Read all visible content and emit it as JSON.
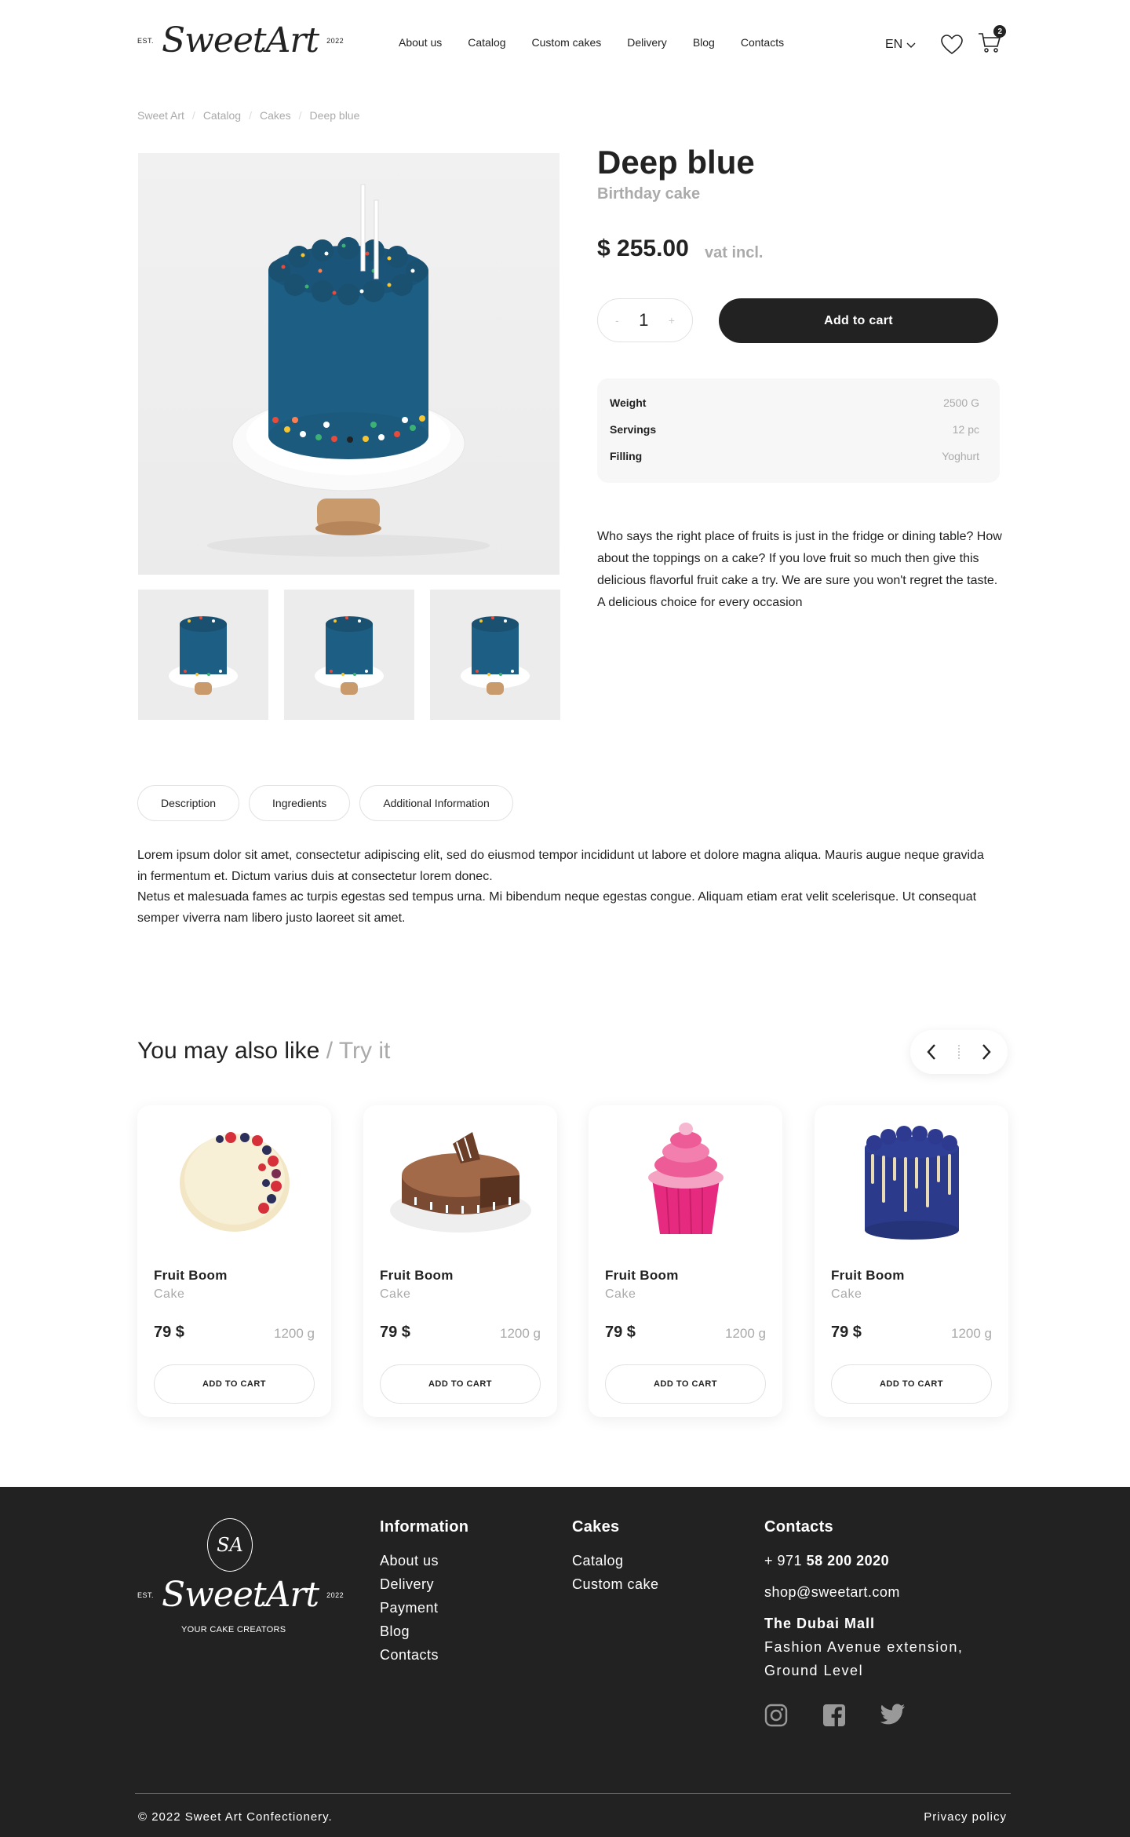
{
  "header": {
    "logo_est": "EST.",
    "logo_name": "SweetArt",
    "logo_year": "2022",
    "nav": [
      "About us",
      "Catalog",
      "Custom cakes",
      "Delivery",
      "Blog",
      "Contacts"
    ],
    "language": "EN",
    "cart_count": "2"
  },
  "breadcrumb": [
    "Sweet Art",
    "Catalog",
    "Cakes",
    "Deep blue"
  ],
  "product": {
    "title": "Deep blue",
    "subtitle": "Birthday cake",
    "price": "$ 255.00",
    "vat": "vat incl.",
    "qty_minus": "-",
    "quantity": "1",
    "qty_plus": "+",
    "add_to_cart": "Add to cart",
    "specs": [
      {
        "label": "Weight",
        "value": "2500 G"
      },
      {
        "label": "Servings",
        "value": "12 pc"
      },
      {
        "label": "Filling",
        "value": "Yoghurt"
      }
    ],
    "description": "Who says the right place of fruits is just in the fridge or dining table? How about the toppings on a cake? If you love fruit so much then give this delicious flavorful fruit cake a try. We are sure you won't regret the taste. A delicious choice for every occasion",
    "image_color": "#1d5f84"
  },
  "tabs": [
    "Description",
    "Ingredients",
    "Additional Information"
  ],
  "tab_content": [
    "Lorem ipsum dolor sit amet, consectetur adipiscing elit, sed do eiusmod tempor incididunt ut labore et dolore magna aliqua. Mauris augue neque gravida in fermentum et. Dictum varius duis at consectetur lorem donec.",
    "Netus et malesuada fames ac turpis egestas sed tempus urna. Mi bibendum neque egestas congue. Aliquam etiam erat velit scelerisque. Ut consequat semper viverra nam libero justo laoreet sit amet."
  ],
  "related": {
    "heading": "You may also like",
    "heading_muted": "/ Try it",
    "cards": [
      {
        "name": "Fruit Boom",
        "type": "Cake",
        "price": "79 $",
        "weight": "1200 g",
        "button": "ADD TO CART",
        "icon": "berry-cake-icon"
      },
      {
        "name": "Fruit Boom",
        "type": "Cake",
        "price": "79 $",
        "weight": "1200 g",
        "button": "ADD TO CART",
        "icon": "chocolate-cake-icon"
      },
      {
        "name": "Fruit Boom",
        "type": "Cake",
        "price": "79 $",
        "weight": "1200 g",
        "button": "ADD TO CART",
        "icon": "cupcake-icon"
      },
      {
        "name": "Fruit Boom",
        "type": "Cake",
        "price": "79 $",
        "weight": "1200 g",
        "button": "ADD TO CART",
        "icon": "blue-drip-cake-icon"
      }
    ]
  },
  "footer": {
    "monogram": "SA",
    "logo_est": "EST.",
    "logo_name": "SweetArt",
    "logo_year": "2022",
    "tagline": "YOUR CAKE CREATORS",
    "information_title": "Information",
    "information_links": [
      "About us",
      "Delivery",
      "Payment",
      "Blog",
      "Contacts"
    ],
    "cakes_title": "Cakes",
    "cakes_links": [
      "Catalog",
      "Custom cake"
    ],
    "contacts_title": "Contacts",
    "phone_prefix": "+ 971",
    "phone_number": "58 200 2020",
    "email": "shop@sweetart.com",
    "location_title": "The Dubai Mall",
    "location_lines": [
      "Fashion Avenue extension,",
      "Ground Level"
    ],
    "copyright": "© 2022 Sweet Art Confectionery.",
    "privacy": "Privacy policy"
  }
}
